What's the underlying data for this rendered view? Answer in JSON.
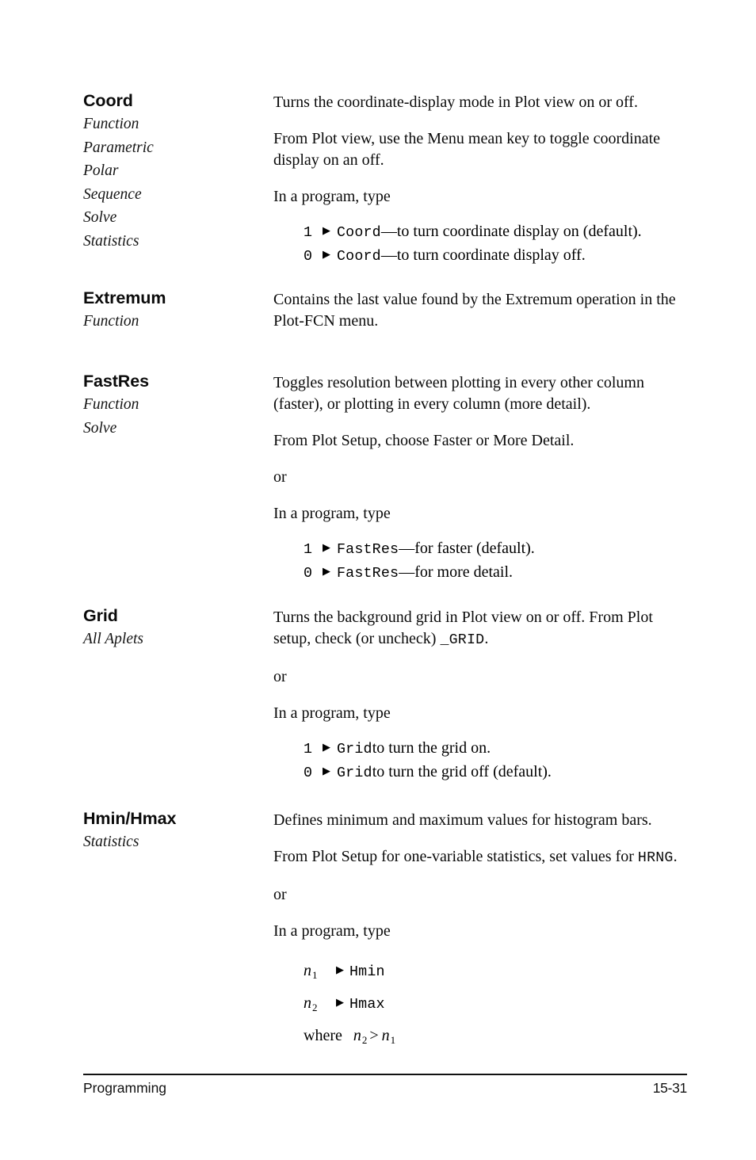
{
  "document": {
    "type": "reference-manual-page",
    "page_label": "15-31",
    "footer_section": "Programming"
  },
  "entries": [
    {
      "name": "Coord",
      "applets": [
        "Function",
        "Parametric",
        "Polar",
        "Sequence",
        "Solve",
        "Statistics"
      ],
      "paragraphs": [
        "Turns the coordinate-display mode in Plot view on or off.",
        "From Plot view, use the Menu mean key to toggle coordinate display on an off.",
        "In a program, type"
      ],
      "code_lines": [
        {
          "num": "1",
          "arrow": "▶",
          "cmd": "Coord",
          "tail": "—to turn coordinate display on (default)."
        },
        {
          "num": "0",
          "arrow": "▶",
          "cmd": "Coord",
          "tail": "—to turn coordinate display off."
        }
      ]
    },
    {
      "name": "Extremum",
      "applets": [
        "Function"
      ],
      "paragraphs": [
        "Contains the last value found by the Extremum operation in the Plot-FCN menu."
      ],
      "code_lines": []
    },
    {
      "name": "FastRes",
      "applets": [
        "Function",
        "Solve"
      ],
      "paragraphs": [
        "Toggles resolution between plotting in every other column (faster), or plotting in every column (more detail).",
        "From Plot Setup, choose Faster or More Detail.",
        "or",
        "In a program, type"
      ],
      "code_lines": [
        {
          "num": "1",
          "arrow": "▶",
          "cmd": "FastRes",
          "tail": "—for faster (default)."
        },
        {
          "num": "0",
          "arrow": "▶",
          "cmd": "FastRes",
          "tail": "—for more detail."
        }
      ]
    },
    {
      "name": "Grid",
      "applets": [
        "All Aplets"
      ],
      "paragraphs_rich": [
        {
          "before": "Turns the background grid in Plot view on or off. From Plot setup, check (or uncheck) ",
          "mono": "_GRID",
          "after": "."
        }
      ],
      "paragraphs": [
        "or",
        "In a program, type"
      ],
      "code_lines": [
        {
          "num": "1",
          "arrow": "▶",
          "cmd": "Grid",
          "tail": " to turn the grid on."
        },
        {
          "num": "0",
          "arrow": "▶",
          "cmd": "Grid",
          "tail": " to turn the grid off (default)."
        }
      ]
    },
    {
      "name": "Hmin/Hmax",
      "applets": [
        "Statistics"
      ],
      "paragraphs": [
        "Defines minimum and maximum values for histogram bars."
      ],
      "paragraphs_rich": [
        {
          "before": "From Plot Setup for one-variable statistics, set values for ",
          "mono": "HRNG",
          "after": "."
        }
      ],
      "paragraphs_after": [
        "or",
        "In a program, type"
      ],
      "var_lines": [
        {
          "var": "n",
          "sub": "1",
          "arrow": "▶",
          "cmd": "Hmin"
        },
        {
          "var": "n",
          "sub": "2",
          "arrow": "▶",
          "cmd": "Hmax"
        }
      ],
      "condition": {
        "label": "where",
        "left_var": "n",
        "left_sub": "2",
        "relation": ">",
        "right_var": "n",
        "right_sub": "1"
      }
    }
  ]
}
